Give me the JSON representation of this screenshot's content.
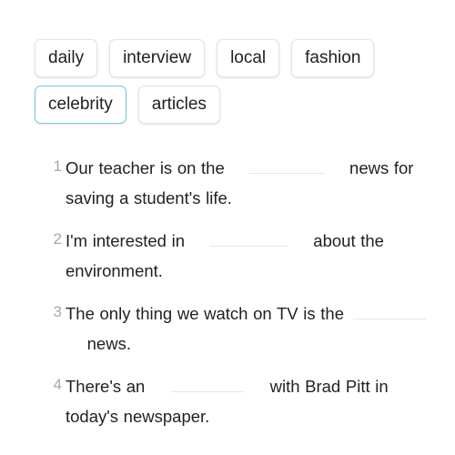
{
  "top_fragment": "∙∙ ∙",
  "colors": {
    "chip_border": "#e3e5e7",
    "chip_selected_border": "#74c4e6",
    "text": "#1f2023",
    "number": "#a2a7ad",
    "blank_line": "#e6e7e9",
    "background": "#ffffff"
  },
  "word_bank": {
    "rows": [
      [
        {
          "label": "daily",
          "selected": false
        },
        {
          "label": "interview",
          "selected": false
        },
        {
          "label": "local",
          "selected": false
        },
        {
          "label": "fashion",
          "selected": false
        }
      ],
      [
        {
          "label": "celebrity",
          "selected": true
        },
        {
          "label": "articles",
          "selected": false
        }
      ]
    ]
  },
  "questions": [
    {
      "number": "1",
      "before": "Our teacher is on the",
      "blank_width": 82,
      "after": "news for saving a student's life.",
      "blank_lead": 18
    },
    {
      "number": "2",
      "before": "I'm interested in",
      "blank_width": 86,
      "after": "about the environment.",
      "blank_lead": 18
    },
    {
      "number": "3",
      "before": "The only thing we watch on TV is the",
      "blank_width": 80,
      "after": "news.",
      "blank_lead": 0
    },
    {
      "number": "4",
      "before": "There's an",
      "blank_width": 82,
      "after": "with Brad Pitt in today's newspaper.",
      "blank_lead": 18
    }
  ]
}
